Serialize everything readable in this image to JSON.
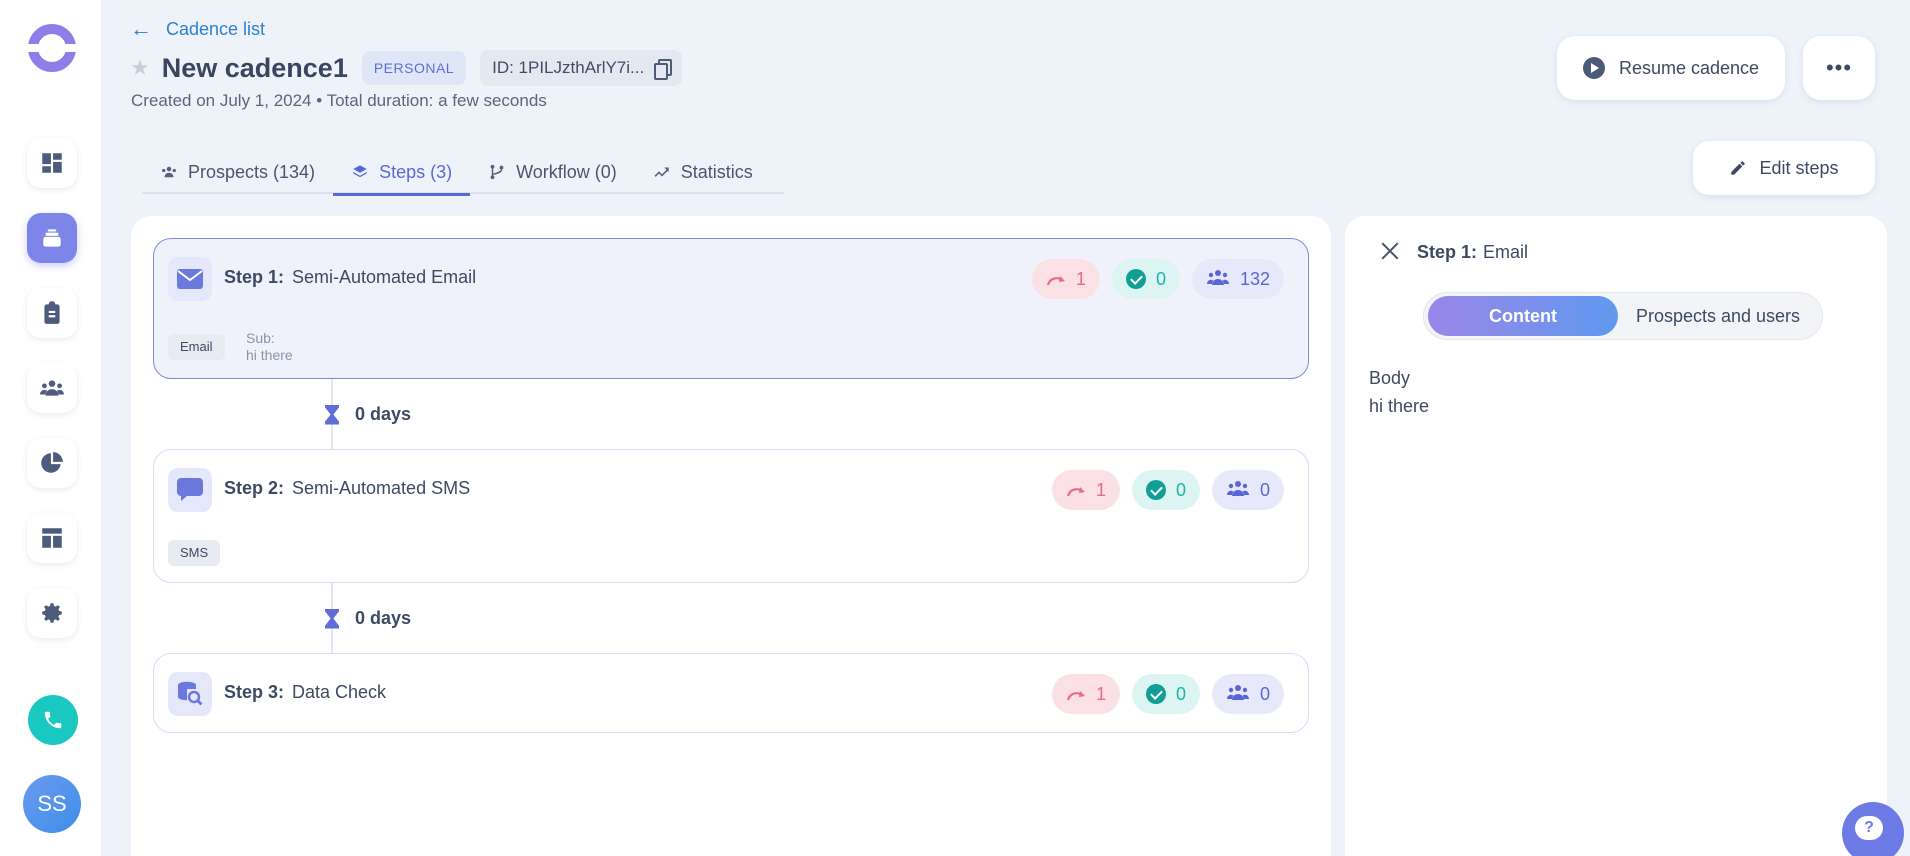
{
  "sidebar": {
    "user_initials": "SS"
  },
  "header": {
    "back_label": "Cadence list",
    "title": "New cadence1",
    "badge": "PERSONAL",
    "id_label": "ID: 1PILJzthArlY7i...",
    "subline": "Created on July 1, 2024 • Total duration: a few seconds",
    "resume_label": "Resume cadence",
    "more_label": "•••"
  },
  "tabs": [
    {
      "label": "Prospects (134)",
      "icon": "people-icon",
      "active": false
    },
    {
      "label": "Steps (3)",
      "icon": "layers-icon",
      "active": true
    },
    {
      "label": "Workflow (0)",
      "icon": "branch-icon",
      "active": false
    },
    {
      "label": "Statistics",
      "icon": "trend-icon",
      "active": false
    }
  ],
  "edit_steps_label": "Edit steps",
  "steps": [
    {
      "prefix": "Step 1:",
      "name": "Semi-Automated Email",
      "icon": "envelope-icon",
      "tag": "Email",
      "sub_label": "Sub:",
      "sub_value": "hi there",
      "skipped": "1",
      "completed": "0",
      "prospects": "132",
      "selected": true
    },
    {
      "prefix": "Step 2:",
      "name": "Semi-Automated SMS",
      "icon": "chat-bubble-icon",
      "tag": "SMS",
      "skipped": "1",
      "completed": "0",
      "prospects": "0",
      "selected": false
    },
    {
      "prefix": "Step 3:",
      "name": "Data Check",
      "icon": "database-search-icon",
      "skipped": "1",
      "completed": "0",
      "prospects": "0",
      "selected": false
    }
  ],
  "delays": [
    "0 days",
    "0 days"
  ],
  "detail": {
    "prefix": "Step 1:",
    "title": "Email",
    "segment_content": "Content",
    "segment_prospects": "Prospects and users",
    "body_label": "Body",
    "body_text": "hi there"
  },
  "help_label": "?",
  "colors": {
    "accent": "#5a69d8",
    "skip": "#ec6a86",
    "done": "#1bb6ad",
    "phone": "#18c8c1"
  }
}
